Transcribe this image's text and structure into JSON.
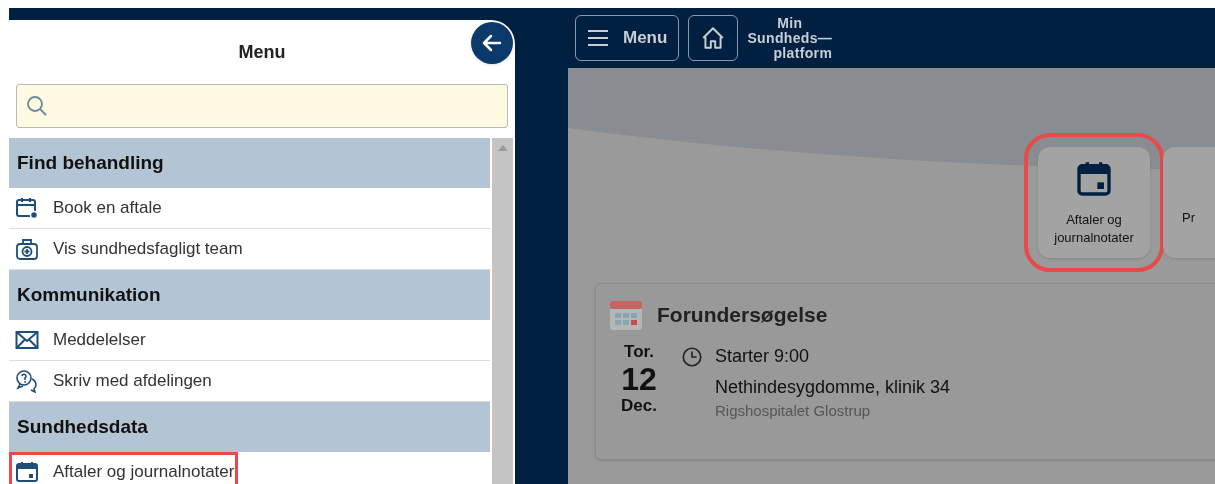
{
  "menu_panel": {
    "title": "Menu",
    "sections": [
      {
        "heading": "Find behandling",
        "items": [
          {
            "label": "Book en aftale",
            "kind": "calendar-plus",
            "highlighted": false
          },
          {
            "label": "Vis sundhedsfagligt team",
            "kind": "medkit",
            "highlighted": false
          }
        ]
      },
      {
        "heading": "Kommunikation",
        "items": [
          {
            "label": "Meddelelser",
            "kind": "mail",
            "highlighted": false
          },
          {
            "label": "Skriv med afdelingen",
            "kind": "chat",
            "highlighted": false
          }
        ]
      },
      {
        "heading": "Sundhedsdata",
        "items": [
          {
            "label": "Aftaler og journalnotater",
            "kind": "calendar",
            "highlighted": true
          }
        ]
      }
    ]
  },
  "header": {
    "menu_button": "Menu",
    "logo": [
      "Min",
      "Sundheds—",
      "platform"
    ]
  },
  "tiles": [
    {
      "label": "Aftaler og journalnotater",
      "kind": "calendar",
      "highlighted": true
    },
    {
      "label": "Pr",
      "kind": "partial",
      "highlighted": false
    }
  ],
  "appointment": {
    "title": "Forundersøgelse",
    "weekday": "Tor.",
    "day": "12",
    "month": "Dec.",
    "time": "Starter 9:00",
    "department": "Nethindesygdomme, klinik 34",
    "location": "Rigshospitalet Glostrup"
  }
}
